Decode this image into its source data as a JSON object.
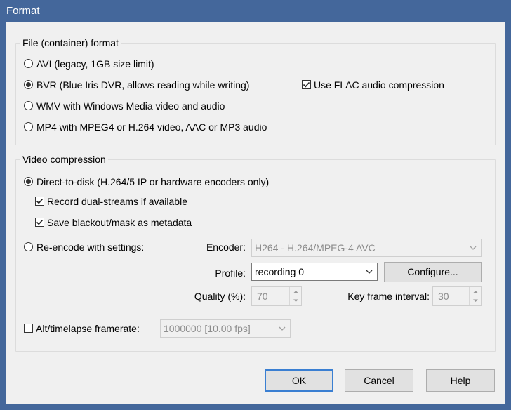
{
  "window": {
    "title": "Format"
  },
  "file_format": {
    "group_label": "File (container) format",
    "options": [
      {
        "label": "AVI (legacy, 1GB size limit)",
        "checked": false
      },
      {
        "label": "BVR (Blue Iris DVR, allows reading while writing)",
        "checked": true
      },
      {
        "label": "WMV with Windows Media video and audio",
        "checked": false
      },
      {
        "label": "MP4 with MPEG4 or H.264 video, AAC or MP3 audio",
        "checked": false
      }
    ],
    "flac": {
      "label": "Use FLAC audio compression",
      "checked": true
    }
  },
  "video_compression": {
    "group_label": "Video compression",
    "direct_to_disk": {
      "label": "Direct-to-disk (H.264/5 IP or hardware encoders only)",
      "checked": true
    },
    "dual_streams": {
      "label": "Record dual-streams if available",
      "checked": true
    },
    "blackout_mask": {
      "label": "Save blackout/mask as metadata",
      "checked": true
    },
    "reencode": {
      "label": "Re-encode with settings:",
      "checked": false
    },
    "encoder": {
      "label": "Encoder:",
      "value": "H264 - H.264/MPEG-4 AVC",
      "disabled": true
    },
    "profile": {
      "label": "Profile:",
      "value": "recording 0"
    },
    "configure_label": "Configure...",
    "quality": {
      "label": "Quality (%):",
      "value": "70",
      "disabled": true
    },
    "key_frame": {
      "label": "Key frame interval:",
      "value": "30",
      "disabled": true
    },
    "timelapse": {
      "label": "Alt/timelapse framerate:",
      "checked": false,
      "value": "1000000 [10.00 fps]",
      "disabled": true
    }
  },
  "buttons": {
    "ok": "OK",
    "cancel": "Cancel",
    "help": "Help"
  },
  "icons": {
    "radio": "radio-icon",
    "checkbox": "checkbox-icon",
    "dropdown": "chevron-down-icon",
    "spin": "spin-arrows-icon"
  },
  "colors": {
    "title_bar": "#44679b",
    "default_button_border": "#3a7fd2",
    "dialog_bg": "#f0f0f0"
  }
}
